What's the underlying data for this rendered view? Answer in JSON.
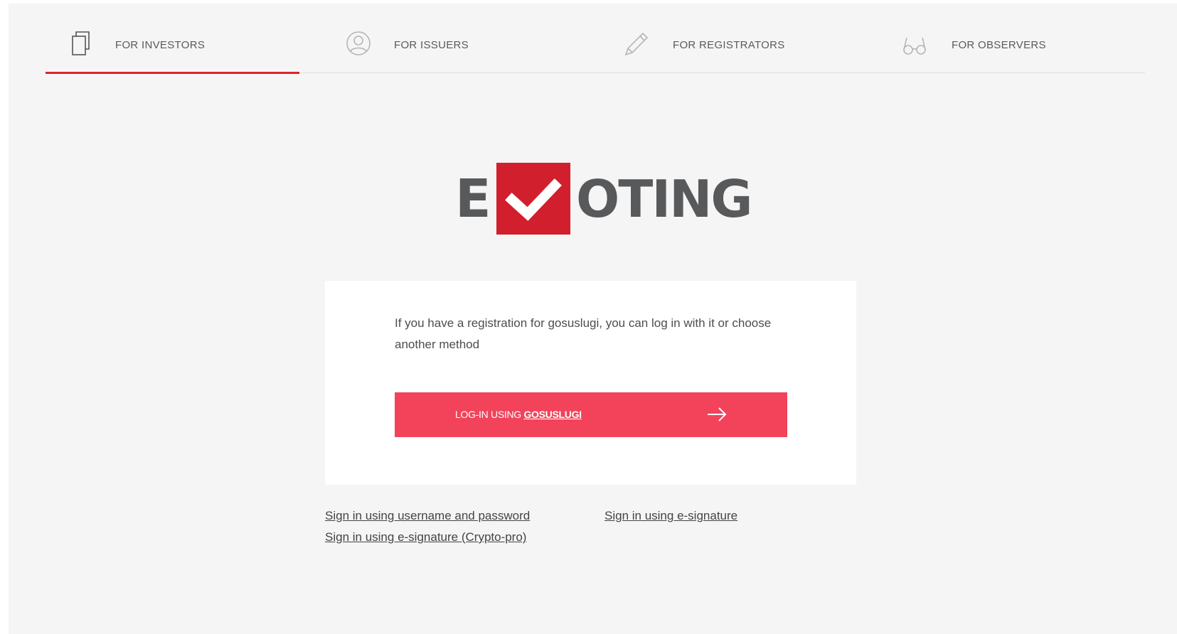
{
  "tabs": [
    {
      "label": "FOR INVESTORS",
      "icon": "copy-icon",
      "active": true
    },
    {
      "label": "FOR ISSUERS",
      "icon": "user-circle-icon",
      "active": false
    },
    {
      "label": "FOR REGISTRATORS",
      "icon": "pencil-icon",
      "active": false
    },
    {
      "label": "FOR OBSERVERS",
      "icon": "glasses-icon",
      "active": false
    }
  ],
  "logo": {
    "first_letter": "E",
    "rest": "OTING",
    "check_icon": "checkmark-icon"
  },
  "card": {
    "intro": "If you have a registration for gosuslugi, you can log in with it or choose another method",
    "button": {
      "prefix": "LOG-IN USING ",
      "brand": "GOSUSLUGI",
      "icon": "arrow-right-icon"
    }
  },
  "links": {
    "password": "Sign in using username and password",
    "esignature": "Sign in using e-signature",
    "crypto": "Sign in using e-signature (Crypto-pro)"
  },
  "colors": {
    "accent": "#e0212d",
    "button": "#f2435a",
    "logo_box": "#d11f2d",
    "logo_text": "#58595b",
    "background": "#f5f5f5"
  }
}
